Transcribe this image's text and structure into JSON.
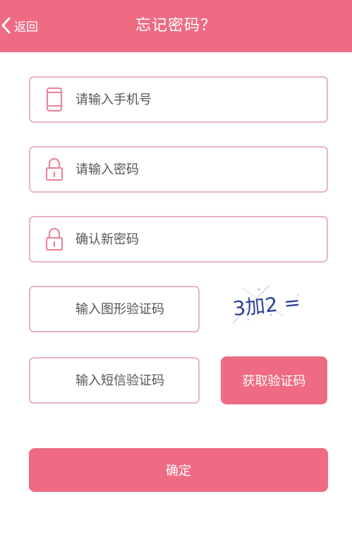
{
  "header": {
    "back_label": "返回",
    "title": "忘记密码？"
  },
  "form": {
    "phone_placeholder": "请输入手机号",
    "password_placeholder": "请输入密码",
    "confirm_password_placeholder": "确认新密码",
    "image_code_placeholder": "输入图形验证码",
    "sms_code_placeholder": "输入短信验证码",
    "captcha_text": "3加2 ="
  },
  "buttons": {
    "get_code_label": "获取验证码",
    "confirm_label": "确定"
  },
  "colors": {
    "accent": "#ef6b84",
    "field_border": "#e8b4c1"
  }
}
